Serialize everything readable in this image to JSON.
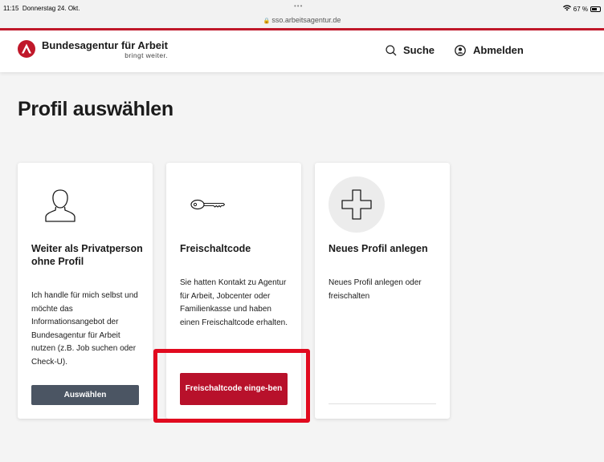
{
  "status_bar": {
    "time": "11:15",
    "date": "Donnerstag 24. Okt.",
    "url": "sso.arbeitsagentur.de",
    "battery": "67 %"
  },
  "header": {
    "brand_name": "Bundesagentur für Arbeit",
    "brand_slogan": "bringt weiter.",
    "search_label": "Suche",
    "logout_label": "Abmelden"
  },
  "page": {
    "title": "Profil auswählen"
  },
  "cards": [
    {
      "title": "Weiter als Privatperson ohne Profil",
      "text": "Ich handle für mich selbst und möchte das Informationsangebot der Bundesagentur für Arbeit nutzen (z.B. Job suchen oder Check-U).",
      "button": "Auswählen"
    },
    {
      "title": "Freischaltcode",
      "text": "Sie hatten Kontakt zu Agentur für Arbeit, Jobcenter oder Familienkasse und haben einen Freischaltcode erhalten.",
      "button": "Freischaltcode einge-ben"
    },
    {
      "title": "Neues Profil anlegen",
      "text": "Neues Profil anlegen oder freischalten"
    }
  ],
  "colors": {
    "brand_red": "#c0182a",
    "button_red": "#b8112b",
    "button_dark": "#4b5563",
    "highlight": "#e10a1f"
  }
}
